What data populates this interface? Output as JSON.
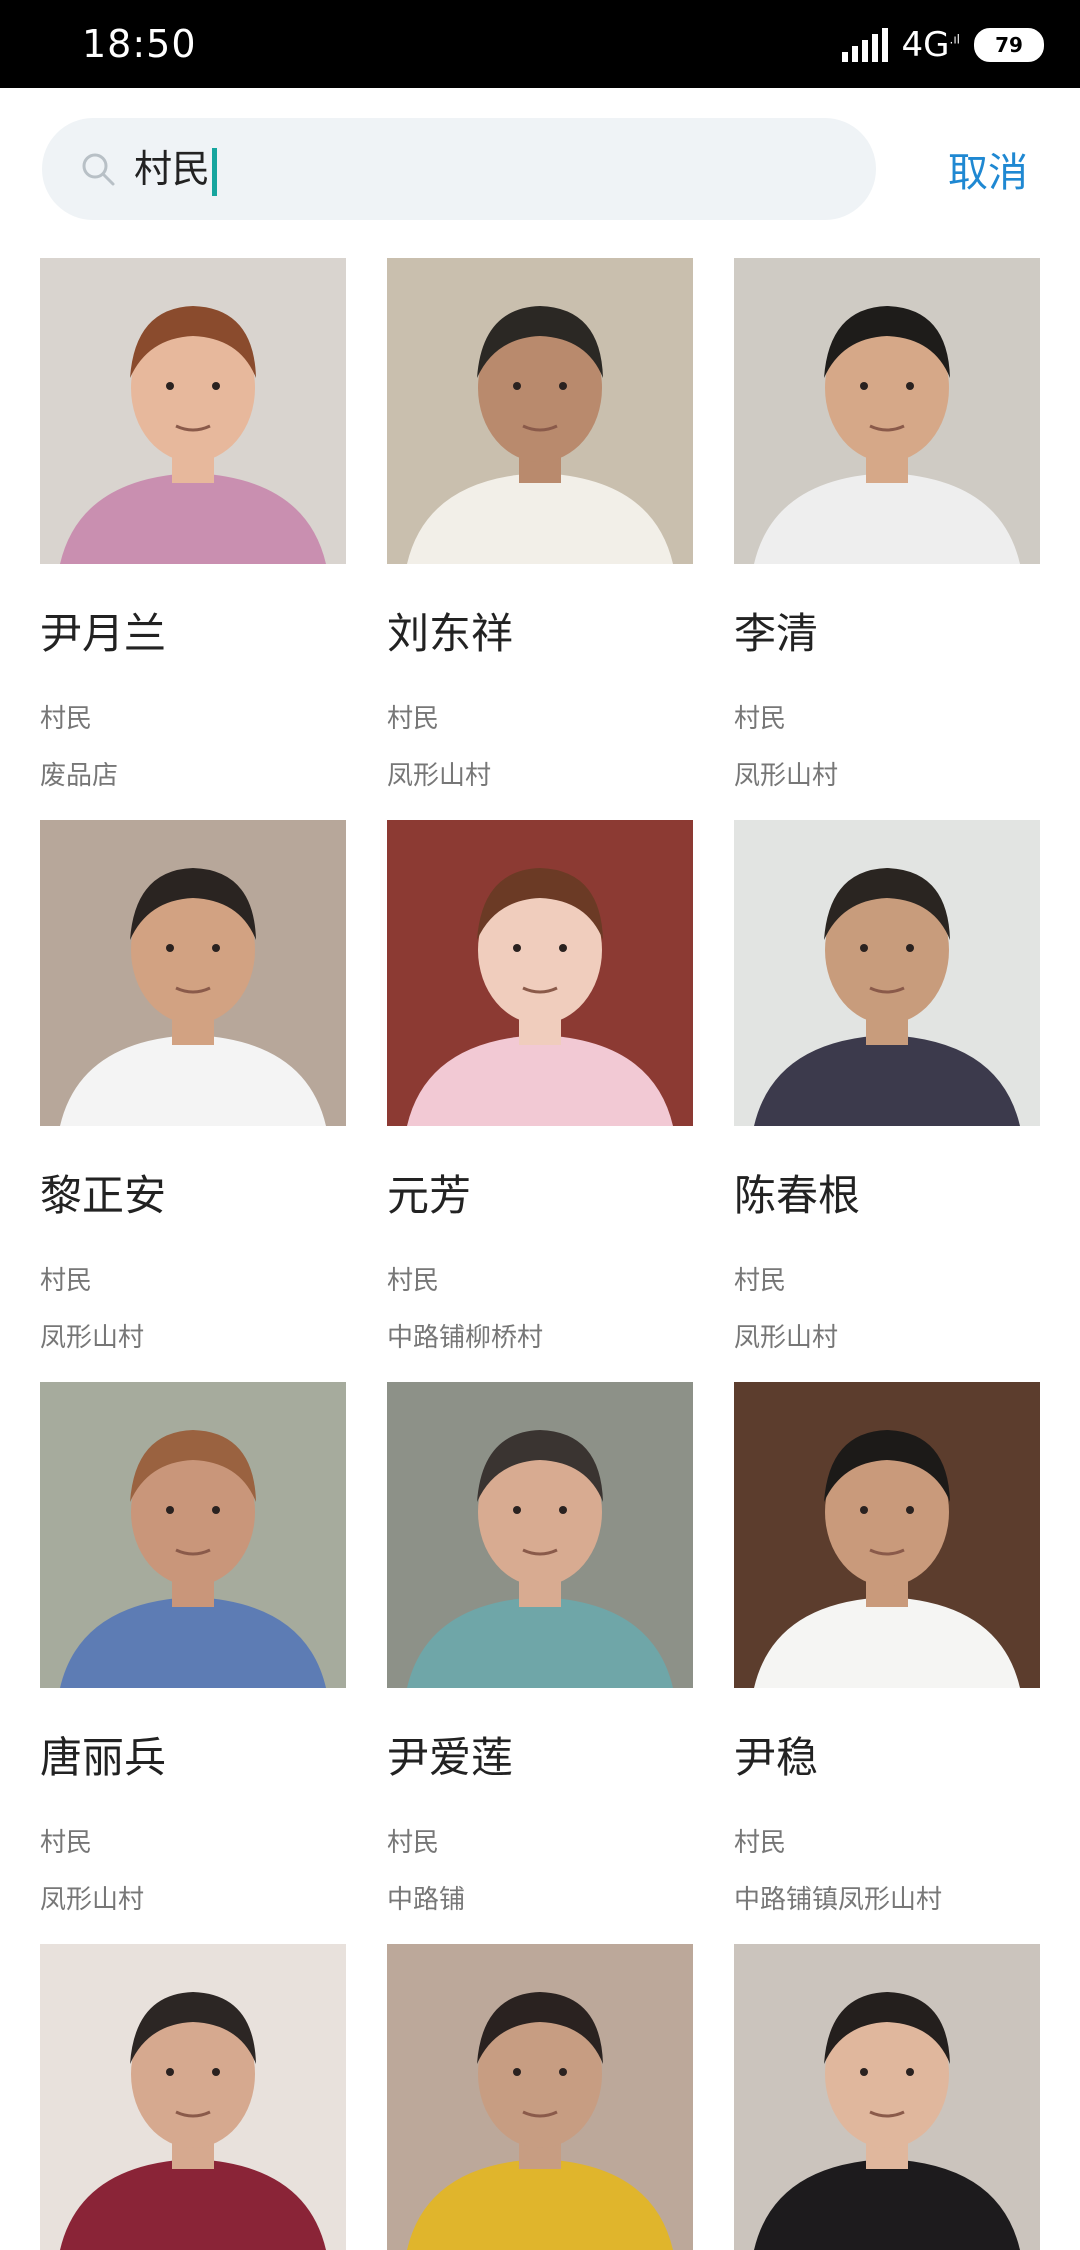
{
  "status_bar": {
    "time": "18:50",
    "network": "4G",
    "battery": "79",
    "icons": [
      "signal-icon",
      "network-4g-icon",
      "battery-icon"
    ]
  },
  "search": {
    "query": "村民",
    "cancel_label": "取消"
  },
  "results": [
    {
      "name": "尹月兰",
      "role": "村民",
      "place": "废品店",
      "bg": "#d9d4cf",
      "shirt": "#c98fb0",
      "hair": "#8a4b2d",
      "skin": "#e7b89c"
    },
    {
      "name": "刘东祥",
      "role": "村民",
      "place": "凤形山村",
      "bg": "#c9bfae",
      "shirt": "#f2efe8",
      "hair": "#2b2824",
      "skin": "#b98a6d"
    },
    {
      "name": "李清",
      "role": "村民",
      "place": "凤形山村",
      "bg": "#cfcbc4",
      "shirt": "#eeeeee",
      "hair": "#1e1c1a",
      "skin": "#d6a888"
    },
    {
      "name": "黎正安",
      "role": "村民",
      "place": "凤形山村",
      "bg": "#b7a79a",
      "shirt": "#f4f4f4",
      "hair": "#2a2421",
      "skin": "#d2a282"
    },
    {
      "name": "元芳",
      "role": "村民",
      "place": "中路铺柳桥村",
      "bg": "#8c3a33",
      "shirt": "#f2c9d4",
      "hair": "#6b3a25",
      "skin": "#f0cdbd"
    },
    {
      "name": "陈春根",
      "role": "村民",
      "place": "凤形山村",
      "bg": "#e2e4e2",
      "shirt": "#3c3a4c",
      "hair": "#2a2521",
      "skin": "#c89c7c"
    },
    {
      "name": "唐丽兵",
      "role": "村民",
      "place": "凤形山村",
      "bg": "#a6ab9d",
      "shirt": "#5d7cb4",
      "hair": "#9a6240",
      "skin": "#c9967a"
    },
    {
      "name": "尹爱莲",
      "role": "村民",
      "place": "中路铺",
      "bg": "#8d9188",
      "shirt": "#6fa6a8",
      "hair": "#3a3431",
      "skin": "#d8ab91"
    },
    {
      "name": "尹稳",
      "role": "村民",
      "place": "中路铺镇凤形山村",
      "bg": "#5c3d2d",
      "shirt": "#f5f5f3",
      "hair": "#1c1a18",
      "skin": "#c99a7b"
    },
    {
      "name": "",
      "role": "",
      "place": "",
      "bg": "#e8e1dc",
      "shirt": "#8a2437",
      "hair": "#2c2624",
      "skin": "#d6a98f"
    },
    {
      "name": "",
      "role": "",
      "place": "",
      "bg": "#bca89a",
      "shirt": "#e0b52c",
      "hair": "#2a2220",
      "skin": "#c79d82"
    },
    {
      "name": "",
      "role": "",
      "place": "",
      "bg": "#cbc4bd",
      "shirt": "#1d1b1d",
      "hair": "#241f1d",
      "skin": "#e0b79d"
    }
  ]
}
